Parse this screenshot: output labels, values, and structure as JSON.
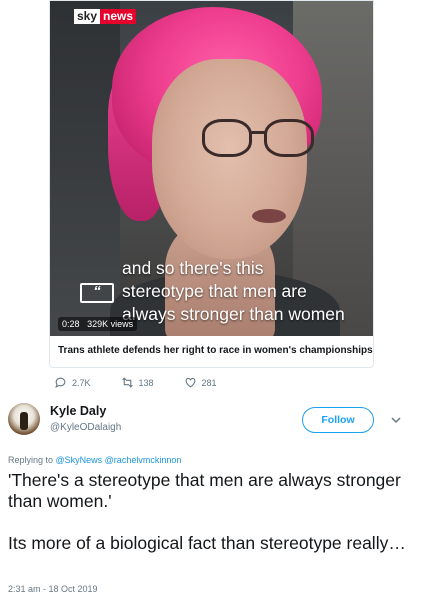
{
  "quoted_card": {
    "logo": {
      "sky": "sky",
      "news": "news",
      "brand_color": "#e4012b"
    },
    "caption_lines": [
      "and so there's this",
      "stereotype that men are",
      "always stronger than women"
    ],
    "quote_icon_glyph": "“",
    "time": "0:28",
    "views": "329K views",
    "title": "Trans athlete defends her right to race in women's championships"
  },
  "actions": {
    "reply_count": "2.7K",
    "retweet_count": "138",
    "like_count": "281",
    "icons": [
      "reply-icon",
      "retweet-icon",
      "like-icon"
    ]
  },
  "tweet": {
    "author_name": "Kyle Daly",
    "author_handle": "@KyleODalaigh",
    "follow_label": "Follow",
    "replying_prefix": "Replying to ",
    "replying_mentions": "@SkyNews @rachelvmckinnon",
    "paragraphs": [
      "'There's a stereotype that men are always stronger than women.'",
      "Its more of a biological fact than stereotype really…"
    ],
    "timestamp": "2:31 am - 18 Oct 2019",
    "accent_color": "#1da1f2"
  }
}
